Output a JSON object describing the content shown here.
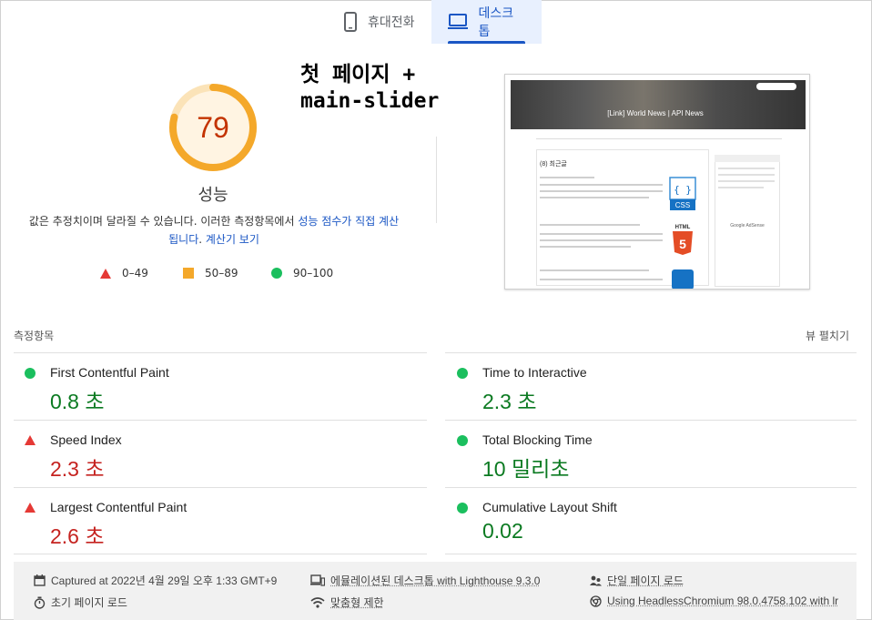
{
  "tabs": [
    {
      "label": "휴대전화",
      "icon": "smartphone-icon",
      "active": false
    },
    {
      "label": "데스크톱",
      "icon": "desktop-icon",
      "active": true
    }
  ],
  "overlay_title": {
    "line1": "첫 페이지 +",
    "line2": "main-slider"
  },
  "score": {
    "value": "79",
    "value_number": 79,
    "label": "성능",
    "color": "#f4a82a"
  },
  "description": {
    "text": "값은 추정치이며 달라질 수 있습니다. 이러한 측정항목에서 ",
    "link1": "성능 점수가 직접 계산됩니다",
    "middle": ". ",
    "link2": "계산기 보기"
  },
  "legend": [
    {
      "label": "0–49",
      "shape": "triangle",
      "color": "#e53935"
    },
    {
      "label": "50–89",
      "shape": "square",
      "color": "#f4a82a"
    },
    {
      "label": "90–100",
      "shape": "circle",
      "color": "#1bbf5e"
    }
  ],
  "preview": {
    "hero_title": "[Link] World News | API News",
    "section_heading": "(8) 최근글",
    "ad_label": "Google AdSense"
  },
  "metrics_section": {
    "title": "측정항목",
    "expand_label": "뷰 펼치기"
  },
  "metrics": [
    {
      "title": "First Contentful Paint",
      "value": "0.8 초",
      "status": "pass"
    },
    {
      "title": "Time to Interactive",
      "value": "2.3 초",
      "status": "pass"
    },
    {
      "title": "Speed Index",
      "value": "2.3 초",
      "status": "fail"
    },
    {
      "title": "Total Blocking Time",
      "value": "10 밀리초",
      "status": "pass"
    },
    {
      "title": "Largest Contentful Paint",
      "value": "2.6 초",
      "status": "fail"
    },
    {
      "title": "Cumulative Layout Shift",
      "value": "0.02",
      "status": "pass"
    }
  ],
  "footer": {
    "captured": "Captured at 2022년 4월 29일 오후 1:33 GMT+9",
    "emulated": "에뮬레이션된 데스크톱 with Lighthouse 9.3.0",
    "single_page": "단일 페이지 로드",
    "initial_load": "초기 페이지 로드",
    "throttling": "맞춤형 제한",
    "browser": "Using HeadlessChromium 98.0.4758.102 with lr"
  },
  "colors": {
    "accent": "#1a56c4",
    "pass": "#0b7a21",
    "fail": "#c5221f",
    "average": "#f4a82a"
  }
}
